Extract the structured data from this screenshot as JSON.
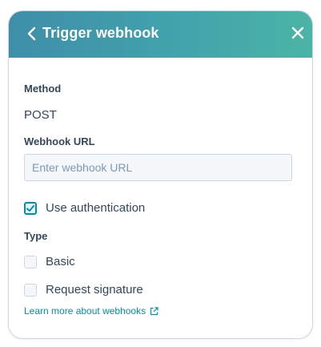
{
  "header": {
    "title": "Trigger webhook",
    "back_icon": "chevron-left-icon",
    "close_icon": "close-icon",
    "gradient_start": "#3e8ea8",
    "gradient_end": "#4cb4a6"
  },
  "method": {
    "label": "Method",
    "value": "POST"
  },
  "webhook_url": {
    "label": "Webhook URL",
    "value": "",
    "placeholder": "Enter webhook URL"
  },
  "authentication": {
    "label": "Use authentication",
    "checked": true
  },
  "type": {
    "label": "Type",
    "options": [
      {
        "label": "Basic",
        "checked": false
      },
      {
        "label": "Request signature",
        "checked": false
      }
    ]
  },
  "learn_more": {
    "label": "Learn more about webhooks",
    "icon": "external-link-icon"
  },
  "colors": {
    "accent": "#0091ae",
    "text": "#33475b",
    "border": "#cbd6e2"
  }
}
